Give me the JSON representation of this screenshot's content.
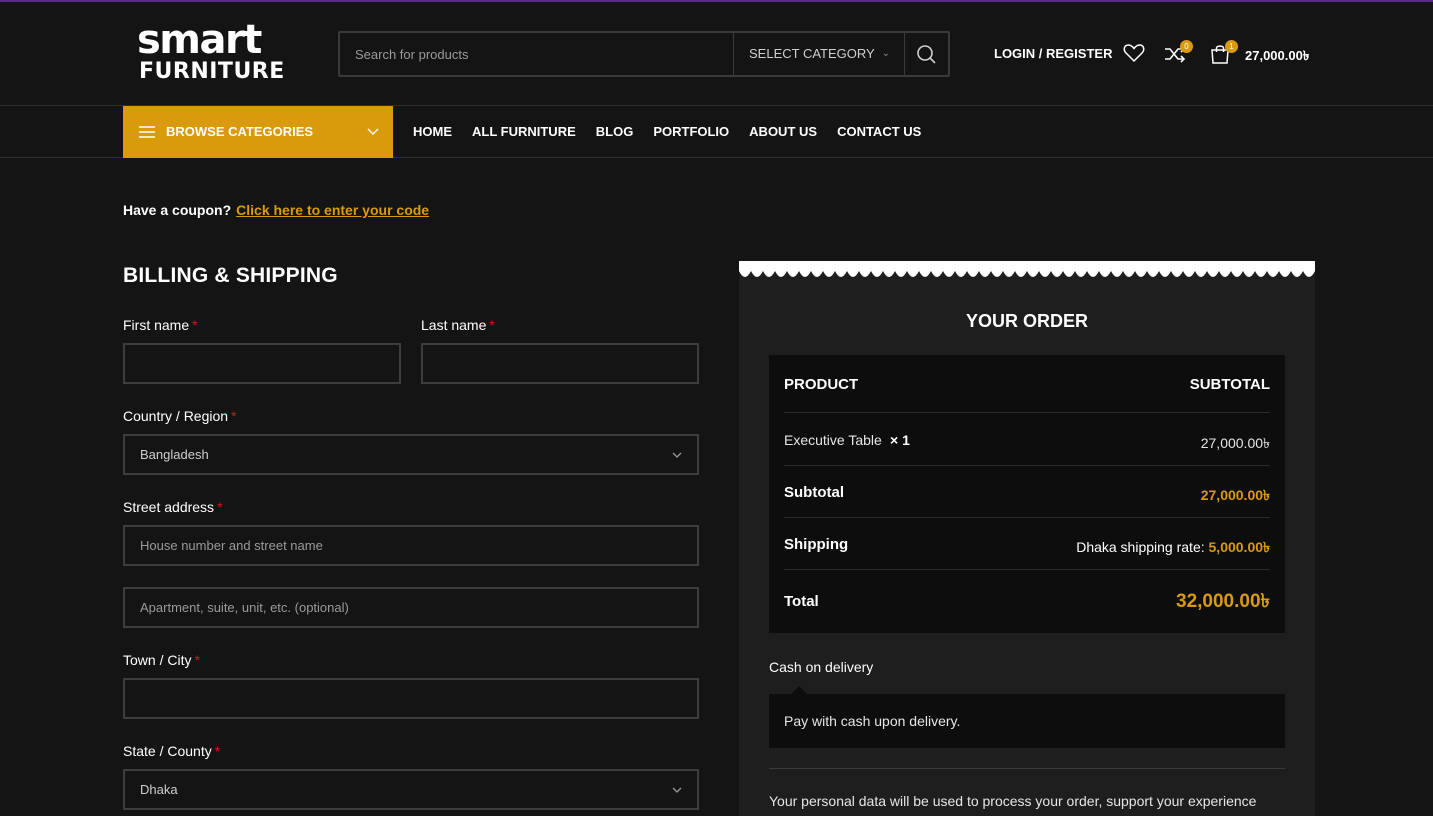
{
  "brand": {
    "logo_line1": "smart",
    "logo_line2": "FURNITURE"
  },
  "header": {
    "search_placeholder": "Search for products",
    "category_select": "SELECT CATEGORY",
    "login": "LOGIN / REGISTER",
    "compare_count": "0",
    "cart_count": "1",
    "cart_total": "27,000.00৳"
  },
  "nav": {
    "browse": "BROWSE CATEGORIES",
    "items": [
      "HOME",
      "ALL FURNITURE",
      "BLOG",
      "PORTFOLIO",
      "ABOUT US",
      "CONTACT US"
    ]
  },
  "coupon": {
    "text": "Have a coupon?",
    "link": "Click here to enter your code"
  },
  "billing": {
    "title": "BILLING & SHIPPING",
    "required_mark": "*",
    "first_name_label": "First name",
    "last_name_label": "Last name",
    "country_label": "Country / Region",
    "country_value": "Bangladesh",
    "street_label": "Street address",
    "street_placeholder": "House number and street name",
    "apartment_placeholder": "Apartment, suite, unit, etc. (optional)",
    "city_label": "Town / City",
    "state_label": "State / County",
    "state_value": "Dhaka"
  },
  "order": {
    "title": "YOUR ORDER",
    "col_product": "PRODUCT",
    "col_subtotal": "SUBTOTAL",
    "item_name": "Executive Table",
    "item_qty": "× 1",
    "item_price": "27,000.00৳",
    "subtotal_label": "Subtotal",
    "subtotal_value": "27,000.00৳",
    "shipping_label": "Shipping",
    "shipping_text": "Dhaka shipping rate:",
    "shipping_value": "5,000.00৳",
    "total_label": "Total",
    "total_value": "32,000.00৳",
    "payment_method": "Cash on delivery",
    "payment_desc": "Pay with cash upon delivery.",
    "privacy": "Your personal data will be used to process your order, support your experience"
  },
  "colors": {
    "accent": "#d99a0c",
    "background": "#141414",
    "required": "#e01020"
  }
}
